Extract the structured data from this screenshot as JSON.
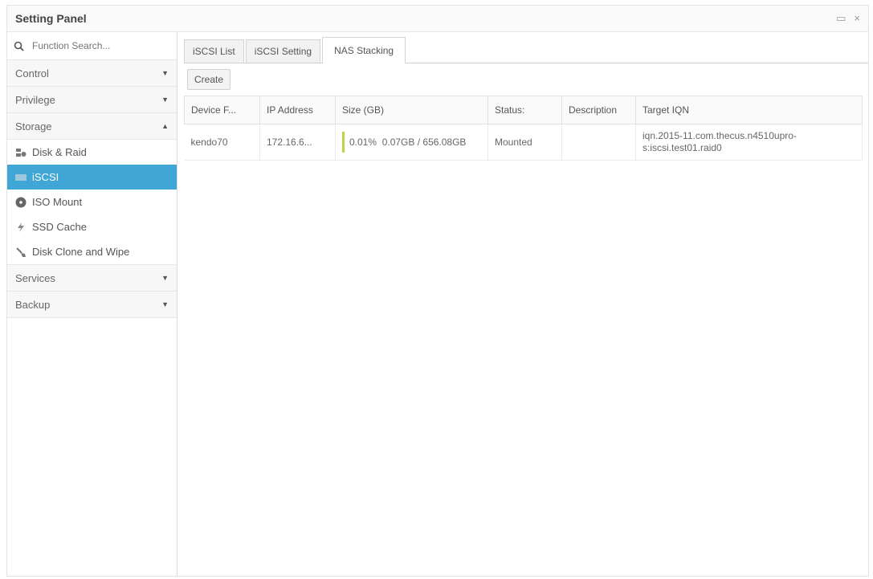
{
  "window": {
    "title": "Setting Panel",
    "restore_symbol": "▭",
    "close_symbol": "×"
  },
  "search": {
    "placeholder": "Function Search..."
  },
  "sidebar": {
    "sections": [
      {
        "label": "Control",
        "arrow": "▼"
      },
      {
        "label": "Privilege",
        "arrow": "▼"
      },
      {
        "label": "Storage",
        "arrow": "▲"
      },
      {
        "label": "Services",
        "arrow": "▼"
      },
      {
        "label": "Backup",
        "arrow": "▼"
      }
    ],
    "storage_items": [
      {
        "label": "Disk & Raid",
        "icon": "disk-raid-icon"
      },
      {
        "label": "iSCSI",
        "icon": "iscsi-icon",
        "active": true
      },
      {
        "label": "ISO Mount",
        "icon": "iso-mount-icon"
      },
      {
        "label": "SSD Cache",
        "icon": "lightning-icon"
      },
      {
        "label": "Disk Clone and Wipe",
        "icon": "brush-icon"
      }
    ]
  },
  "tabs": [
    {
      "label": "iSCSI List"
    },
    {
      "label": "iSCSI Setting"
    },
    {
      "label": "NAS Stacking",
      "active": true
    }
  ],
  "toolbar": {
    "create_label": "Create"
  },
  "table": {
    "columns": [
      "Device F...",
      "IP Address",
      "Size (GB)",
      "Status:",
      "Description",
      "Target IQN"
    ],
    "rows": [
      {
        "device": "kendo70",
        "ip": "172.16.6...",
        "size_percent": "0.01%",
        "size_detail": "0.07GB / 656.08GB",
        "status": "Mounted",
        "description": "",
        "iqn": "iqn.2015-11.com.thecus.n4510upro-s:iscsi.test01.raid0"
      }
    ]
  },
  "colors": {
    "accent": "#3fa6d6",
    "usage_bar": "#b7d64a"
  }
}
